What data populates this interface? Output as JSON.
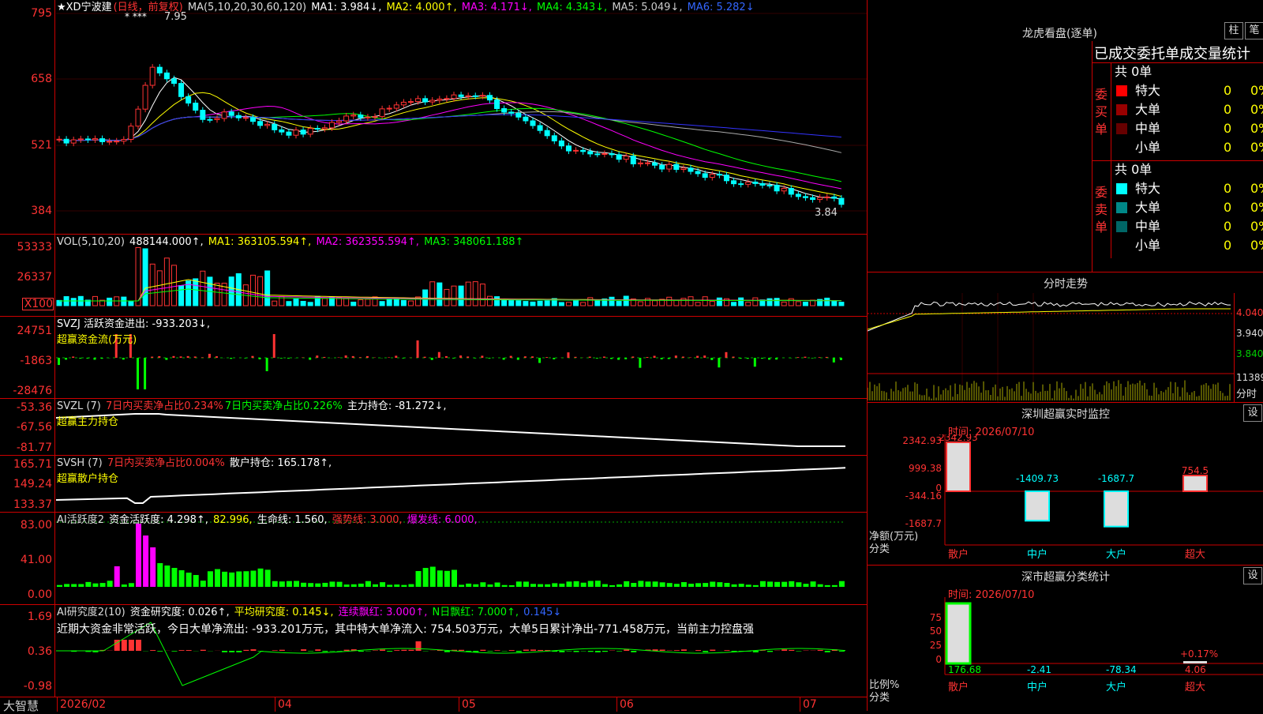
{
  "colors": {
    "up": "#ff3333",
    "down": "#00ffff",
    "ma1": "#ffffff",
    "ma2": "#ffff00",
    "ma3": "#ff00ff",
    "ma4": "#00ff00",
    "ma5": "#aaaaaa",
    "ma6": "#3333ff",
    "grid": "#cc0000"
  },
  "main": {
    "title": "★XD宁波建",
    "period": "(日线，前复权)",
    "ma_param": "MA(5,10,20,30,60,120)",
    "ma1": "MA1: 3.984↓,",
    "ma2": "MA2: 4.000↑,",
    "ma3": "MA3: 4.171↓,",
    "ma4": "MA4: 4.343↓,",
    "ma5": "MA5: 5.049↓,",
    "ma6": "MA6: 5.282↓",
    "y_ticks": [
      "795",
      "658",
      "521",
      "384"
    ],
    "high_label": "7.95",
    "low_label": "3.84",
    "stars": "*  ***"
  },
  "vol": {
    "hdr": "VOL(5,10,20)",
    "val": "488144.000↑,",
    "ma1": "MA1: 363105.594↑,",
    "ma2": "MA2: 362355.594↑,",
    "ma3": "MA3: 348061.188↑",
    "y_ticks": [
      "53333",
      "26337",
      "X100"
    ]
  },
  "svzj": {
    "hdr": "SVZJ  活跃资金进出: -933.203↓,",
    "sub": "超赢资金流(万元)",
    "y_ticks": [
      "24751",
      "-1863",
      "-28476"
    ]
  },
  "svzl": {
    "hdr": "SVZL (7)",
    "a": "7日内买卖净占比0.234%",
    "b": "7日内买卖净占比0.226%",
    "c": "主力持仓: -81.272↓,",
    "sub": "超赢主力持仓",
    "y_ticks": [
      "-53.36",
      "-67.56",
      "-81.77"
    ]
  },
  "svsh": {
    "hdr": "SVSH (7)",
    "a": "7日内买卖净占比0.004%",
    "c": "散户持仓: 165.178↑,",
    "sub": "超赢散户持仓",
    "y_ticks": [
      "165.71",
      "149.24",
      "133.37"
    ]
  },
  "ai1": {
    "hdr": "AI活跃度2",
    "a": "资金活跃度: 4.298↑,",
    "b": "82.996,",
    "c": "生命线: 1.560,",
    "d": "强势线: 3.000,",
    "e": "爆发线: 6.000,",
    "y_ticks": [
      "83.00",
      "41.00",
      "0.00"
    ]
  },
  "ai2": {
    "hdr": "AI研究度2(10)",
    "a": "资金研究度: 0.026↑,",
    "b": "平均研究度: 0.145↓,",
    "c": "连续飘红: 3.000↑,",
    "d": "N日飘红: 7.000↑,",
    "e": "0.145↓",
    "text": "近期大资金非常活跃，今日大单净流出: -933.201万元，其中特大单净流入: 754.503万元，大单5日累计净出-771.458万元，当前主力控盘强",
    "y_ticks": [
      "1.69",
      "0.36",
      "-0.98"
    ]
  },
  "xaxis": {
    "logo": "大智慧",
    "dates": [
      "2026/02",
      "04",
      "05",
      "06",
      "07"
    ]
  },
  "right": {
    "lhb_title": "龙虎看盘(逐单)",
    "btn_zhu": "柱",
    "btn_bi": "笔",
    "order_title": "已成交委托单成交量统计",
    "buy_total": "共 0单",
    "sell_total": "共 0单",
    "buy_side": "委买单",
    "sell_side": "委卖单",
    "buy_rows": [
      {
        "label": "特大",
        "count": "0",
        "pct": "0%",
        "color": "#ff0000"
      },
      {
        "label": "大单",
        "count": "0",
        "pct": "0%",
        "color": "#990000"
      },
      {
        "label": "中单",
        "count": "0",
        "pct": "0%",
        "color": "#660000"
      },
      {
        "label": "小单",
        "count": "0",
        "pct": "0%",
        "color": "#000000"
      }
    ],
    "sell_rows": [
      {
        "label": "特大",
        "count": "0",
        "pct": "0%",
        "color": "#00ffff"
      },
      {
        "label": "大单",
        "count": "0",
        "pct": "0%",
        "color": "#008888"
      },
      {
        "label": "中单",
        "count": "0",
        "pct": "0%",
        "color": "#006666"
      },
      {
        "label": "小单",
        "count": "0",
        "pct": "0%",
        "color": "#000000"
      }
    ],
    "tick_title": "分时走势",
    "tick_ylabels": [
      "4.040",
      "3.940",
      "3.840",
      "11389",
      "分时"
    ],
    "sz_title": "深圳超赢实时监控",
    "sz_btn": "设",
    "sz_time": "时间: 2026/07/10",
    "sz_ylabels": [
      "2342.93",
      "999.38",
      "0",
      "-344.16",
      "-1687.7"
    ],
    "sz_bars": [
      {
        "cat": "散户",
        "val": "2342.93"
      },
      {
        "cat": "中户",
        "val": "-1409.73"
      },
      {
        "cat": "大户",
        "val": "-1687.7"
      },
      {
        "cat": "超大",
        "val": "754.5"
      }
    ],
    "sz_unit": "净额(万元)",
    "sz_unit2": "分类",
    "fl_title": "深市超赢分类统计",
    "fl_btn": "设",
    "fl_time": "时间: 2026/07/10",
    "fl_ylabels": [
      "75",
      "50",
      "25",
      "0"
    ],
    "fl_bars": [
      {
        "cat": "散户",
        "val": "176.68"
      },
      {
        "cat": "中户",
        "val": "-2.41"
      },
      {
        "cat": "大户",
        "val": "-78.34"
      },
      {
        "cat": "超大",
        "val": "4.06"
      }
    ],
    "fl_pct": "+0.17%",
    "fl_unit": "比例%",
    "fl_unit2": "分类"
  }
}
